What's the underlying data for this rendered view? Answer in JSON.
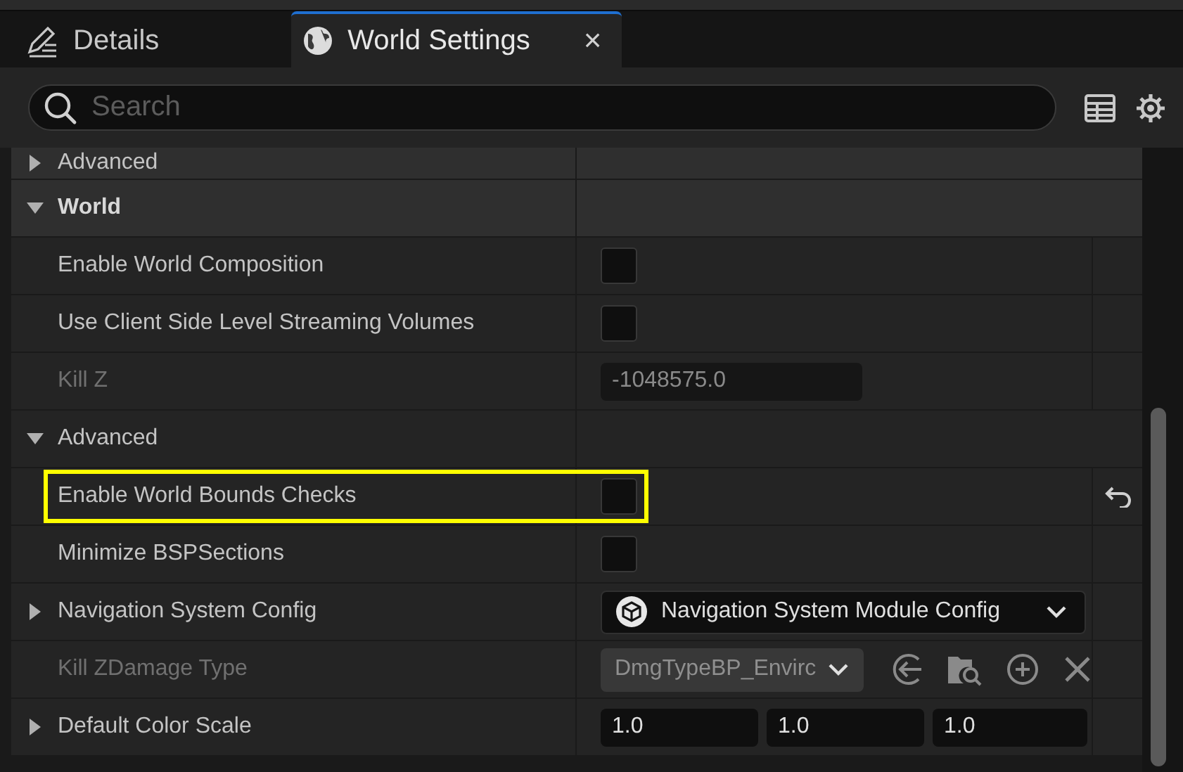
{
  "tabs": [
    {
      "label": "Details",
      "selected": false
    },
    {
      "label": "World Settings",
      "selected": true,
      "close": "×"
    }
  ],
  "search": {
    "placeholder": "Search"
  },
  "properties": [
    {
      "kind": "group",
      "label": "Advanced",
      "expanded": false,
      "disabled": false,
      "highlighted": false,
      "resettable": false
    },
    {
      "kind": "category",
      "label": "World",
      "expanded": true,
      "disabled": false,
      "highlighted": false,
      "resettable": false
    },
    {
      "kind": "checkbox",
      "label": "Enable World Composition",
      "checked": false,
      "disabled": false,
      "highlighted": false,
      "resettable": false
    },
    {
      "kind": "checkbox",
      "label": "Use Client Side Level Streaming Volumes",
      "checked": false,
      "disabled": false,
      "highlighted": false,
      "resettable": false
    },
    {
      "kind": "number",
      "label": "Kill Z",
      "value": "-1048575.0",
      "disabled": true,
      "highlighted": false,
      "resettable": false
    },
    {
      "kind": "group",
      "label": "Advanced",
      "expanded": true,
      "disabled": false,
      "highlighted": false,
      "resettable": false
    },
    {
      "kind": "checkbox",
      "label": "Enable World Bounds Checks",
      "checked": false,
      "disabled": false,
      "highlighted": true,
      "resettable": true
    },
    {
      "kind": "checkbox",
      "label": "Minimize BSPSections",
      "checked": false,
      "disabled": false,
      "highlighted": false,
      "resettable": false
    },
    {
      "kind": "dropdown",
      "label": "Navigation System Config",
      "value": "Navigation System Module Config",
      "expanded": false,
      "disabled": false,
      "highlighted": false,
      "resettable": false
    },
    {
      "kind": "asset",
      "label": "Kill ZDamage Type",
      "value": "DmgTypeBP_Envirc",
      "disabled": true,
      "highlighted": false,
      "resettable": false
    },
    {
      "kind": "vector",
      "label": "Default Color Scale",
      "values": [
        "1.0",
        "1.0",
        "1.0"
      ],
      "expanded": false,
      "disabled": false,
      "highlighted": false,
      "resettable": false
    }
  ]
}
